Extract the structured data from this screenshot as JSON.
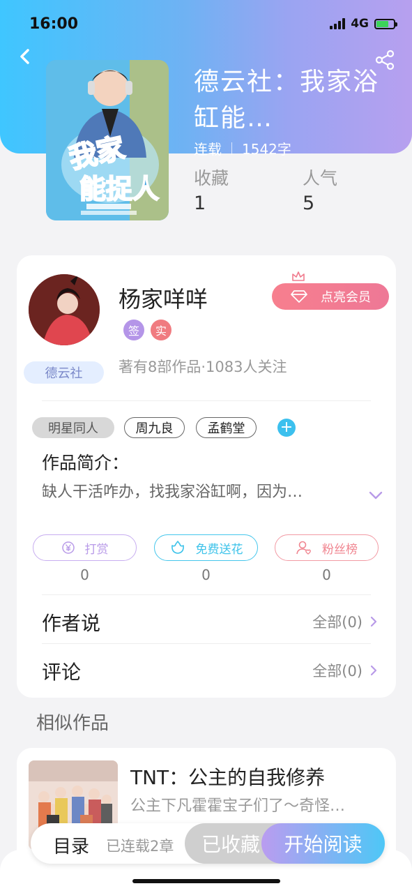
{
  "status_bar": {
    "time": "16:00",
    "network": "4G"
  },
  "book": {
    "title": "德云社：我家浴缸能…",
    "status": "连载",
    "word_count": "1542字",
    "stats": [
      {
        "label": "收藏",
        "value": "1"
      },
      {
        "label": "人气",
        "value": "5"
      }
    ]
  },
  "author": {
    "name": "杨家咩咩",
    "community_tag": "德云社",
    "badges": [
      "签",
      "实"
    ],
    "works_info": "著有8部作品·1083人关注",
    "vip_button": "点亮会员"
  },
  "tags": [
    "明星同人",
    "周九良",
    "孟鹤堂"
  ],
  "intro": {
    "heading": "作品简介：",
    "text": "缺人干活咋办，找我家浴缸啊，因为…"
  },
  "actions": [
    {
      "label": "打赏",
      "count": "0",
      "color": "#b89ae8",
      "icon": "yen-coin-icon"
    },
    {
      "label": "免费送花",
      "count": "0",
      "color": "#3ec3ea",
      "icon": "flower-icon"
    },
    {
      "label": "粉丝榜",
      "count": "0",
      "color": "#f08590",
      "icon": "fan-user-icon"
    }
  ],
  "rows": [
    {
      "title": "作者说",
      "right": "全部(0)"
    },
    {
      "title": "评论",
      "right": "全部(0)"
    }
  ],
  "similar": {
    "heading": "相似作品",
    "items": [
      {
        "title": "TNT：公主的自我修养",
        "desc": "公主下凡霍霍宝子们了～奇怪…"
      }
    ]
  },
  "bottom_bar": {
    "toc": "目录",
    "chapters": "已连载2章",
    "favorited": "已收藏",
    "start_reading": "开始阅读"
  },
  "colors": {
    "header_start": "#3fc6ff",
    "header_end": "#b7a0ef",
    "accent_purple": "#b89ae8",
    "accent_cyan": "#3ec3ea",
    "accent_pink": "#f08590"
  }
}
